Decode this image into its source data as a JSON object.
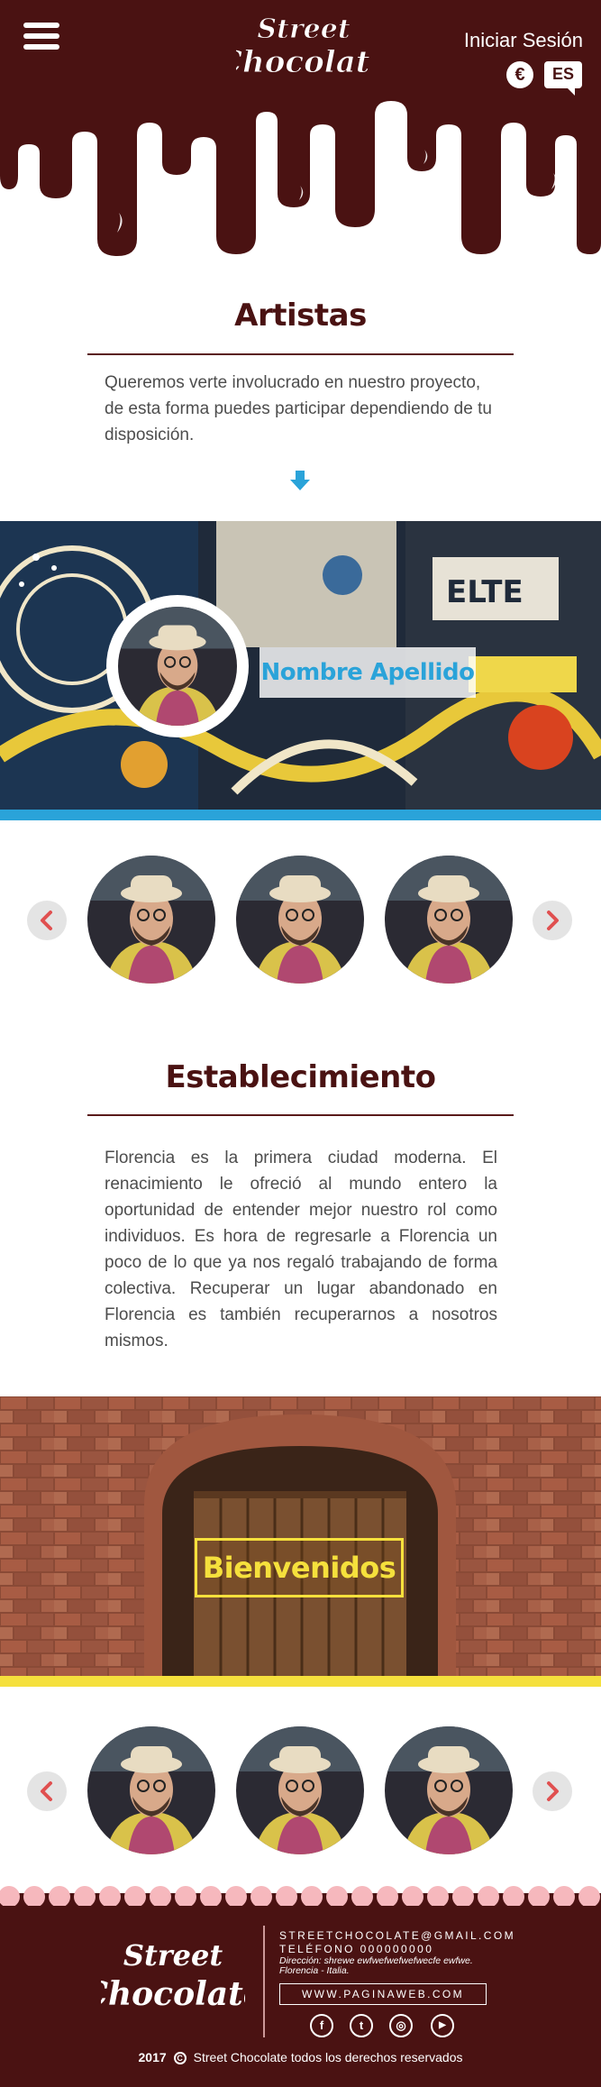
{
  "header": {
    "menu_icon": "hamburger-icon",
    "logo_line1": "Street",
    "logo_line2": "Chocolate",
    "login_label": "Iniciar Sesión",
    "currency_symbol": "€",
    "language": "ES",
    "bg_color": "#4a1212"
  },
  "artists": {
    "title": "Artistas",
    "intro": "Queremos verte involucrado en nuestro proyecto, de esta forma puedes participar dependiendo de tu disposición.",
    "arrow_icon": "arrow-down-icon",
    "arrow_color": "#2aa3d9",
    "featured_name": "Nombre Apellido",
    "stripe_color": "#2aa3d9",
    "carousel": {
      "prev_icon": "chevron-left-icon",
      "next_icon": "chevron-right-icon",
      "avatars": [
        "artist-avatar",
        "artist-avatar",
        "artist-avatar"
      ]
    }
  },
  "venue": {
    "title": "Establecimiento",
    "text": "Florencia es la primera ciudad moderna. El renacimiento le ofreció al mundo entero la oportunidad de entender mejor nuestro rol como individuos. Es hora de regresarle a Florencia un poco de lo que ya nos regaló trabajando de forma colectiva. Recuperar un lugar abandonado en Florencia es también recuperarnos a nosotros mismos.",
    "banner_label": "Bienvenidos",
    "stripe_color": "#f5e03c",
    "carousel": {
      "prev_icon": "chevron-left-icon",
      "next_icon": "chevron-right-icon",
      "avatars": [
        "venue-avatar",
        "venue-avatar",
        "venue-avatar"
      ]
    }
  },
  "footer": {
    "logo_line1": "Street",
    "logo_line2": "Chocolate",
    "email": "STREETCHOCOLATE@GMAIL.COM",
    "phone": "TELÉFONO 000000000",
    "address_line1": "Dirección: shrewe ewfwefwefwefwecfe ewfwe.",
    "address_line2": "Florencia - Italia.",
    "website": "WWW.PAGINAWEB.COM",
    "social": [
      {
        "icon": "facebook-icon",
        "glyph": "f"
      },
      {
        "icon": "twitter-icon",
        "glyph": "t"
      },
      {
        "icon": "instagram-icon",
        "glyph": "◎"
      },
      {
        "icon": "youtube-icon",
        "glyph": "▶"
      }
    ],
    "year": "2017",
    "copyright": "Street Chocolate todos los derechos reservados",
    "bg_color": "#4a1212",
    "scallop_color": "#f6b8bd"
  }
}
